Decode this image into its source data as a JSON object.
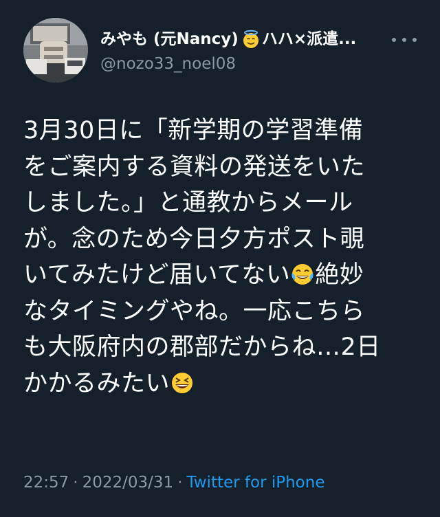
{
  "author": {
    "display_name": "みやも (元Nancy)",
    "display_name_suffix": "ハハ×派遣...",
    "handle": "@nozo33_noel08",
    "name_emoji": "smiling-face-with-halo-icon"
  },
  "tweet": {
    "lines": [
      {
        "text": "3月30日に「新学期の学習準備"
      },
      {
        "text": "をご案内する資料の発送をいた"
      },
      {
        "text": "しました。」と通教からメール"
      },
      {
        "text": "が。念のため今日夕方ポスト覗"
      },
      {
        "text": "いてみたけど届いてない",
        "after": "絶妙"
      },
      {
        "text": "なタイミングやね。一応こちら"
      },
      {
        "text": "も大阪府内の郡部だからね…2日"
      },
      {
        "text": "かかるみたい"
      }
    ],
    "emoji_1": "face-with-tears-of-joy-icon",
    "emoji_2": "grinning-squinting-face-icon"
  },
  "meta": {
    "time": "22:57",
    "separator": "·",
    "date": "2022/03/31",
    "source": "Twitter for iPhone"
  },
  "colors": {
    "background": "#15202b",
    "text": "#ffffff",
    "secondary": "#8b98a5",
    "link": "#1d9bf0"
  }
}
